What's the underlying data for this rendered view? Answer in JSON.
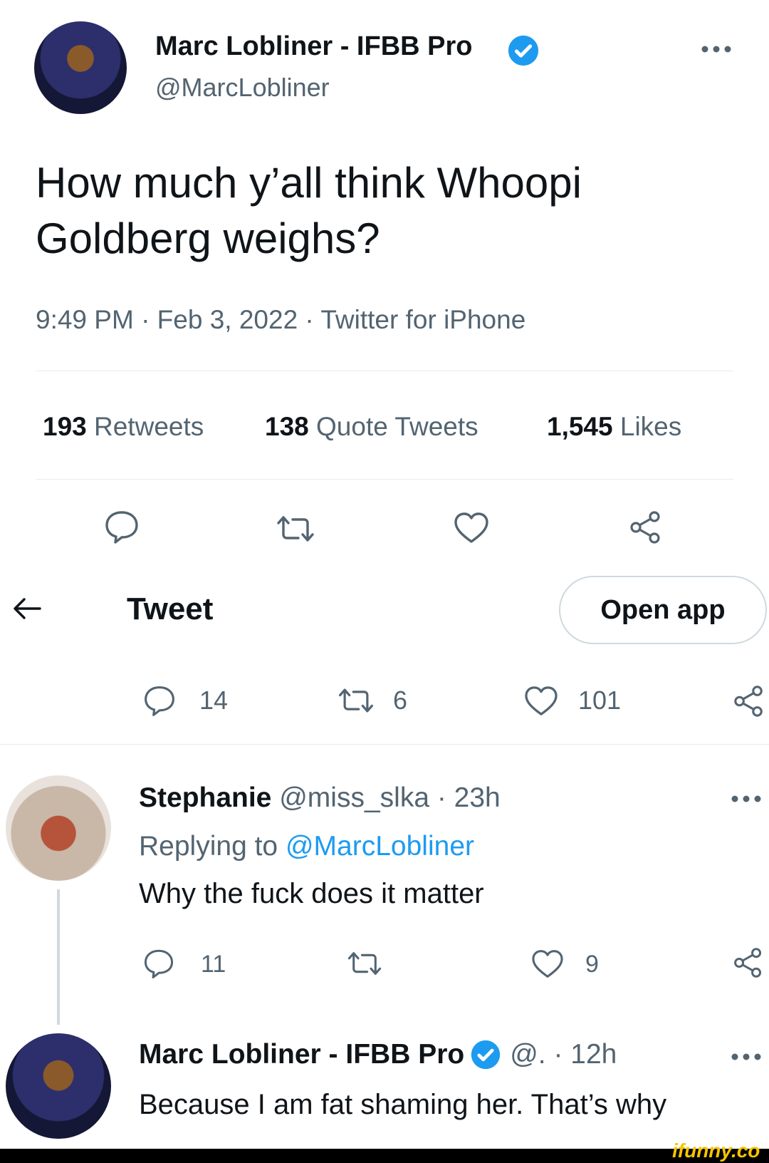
{
  "main_tweet": {
    "author_name": "Marc Lobliner - IFBB Pro",
    "author_handle": "@MarcLobliner",
    "text_line1": "How much y’all think Whoopi",
    "text_line2": "Goldberg weighs?",
    "meta": "9:49 PM · Feb 3, 2022 · Twitter for iPhone",
    "retweets_count": "193",
    "retweets_label": "Retweets",
    "quotes_count": "138",
    "quotes_label": "Quote Tweets",
    "likes_count": "1,545",
    "likes_label": "Likes"
  },
  "header": {
    "back_icon": "arrow-left-icon",
    "title": "Tweet",
    "open_app_label": "Open app"
  },
  "action_counts": {
    "replies": "14",
    "retweets": "6",
    "likes": "101"
  },
  "reply1": {
    "name": "Stephanie",
    "handle_time": "@miss_slka · 23h",
    "replying_prefix": "Replying to",
    "replying_to": "@MarcLobliner",
    "text": "Why the fuck does it matter",
    "replies": "11",
    "likes": "9"
  },
  "reply2": {
    "name": "Marc Lobliner - IFBB Pro",
    "handle_time": "@. · 12h",
    "text": "Because I am fat shaming her. That’s why"
  },
  "watermark": "ifunny.co",
  "colors": {
    "accent": "#1d9bf0",
    "text": "#0f1419",
    "muted": "#536471"
  }
}
